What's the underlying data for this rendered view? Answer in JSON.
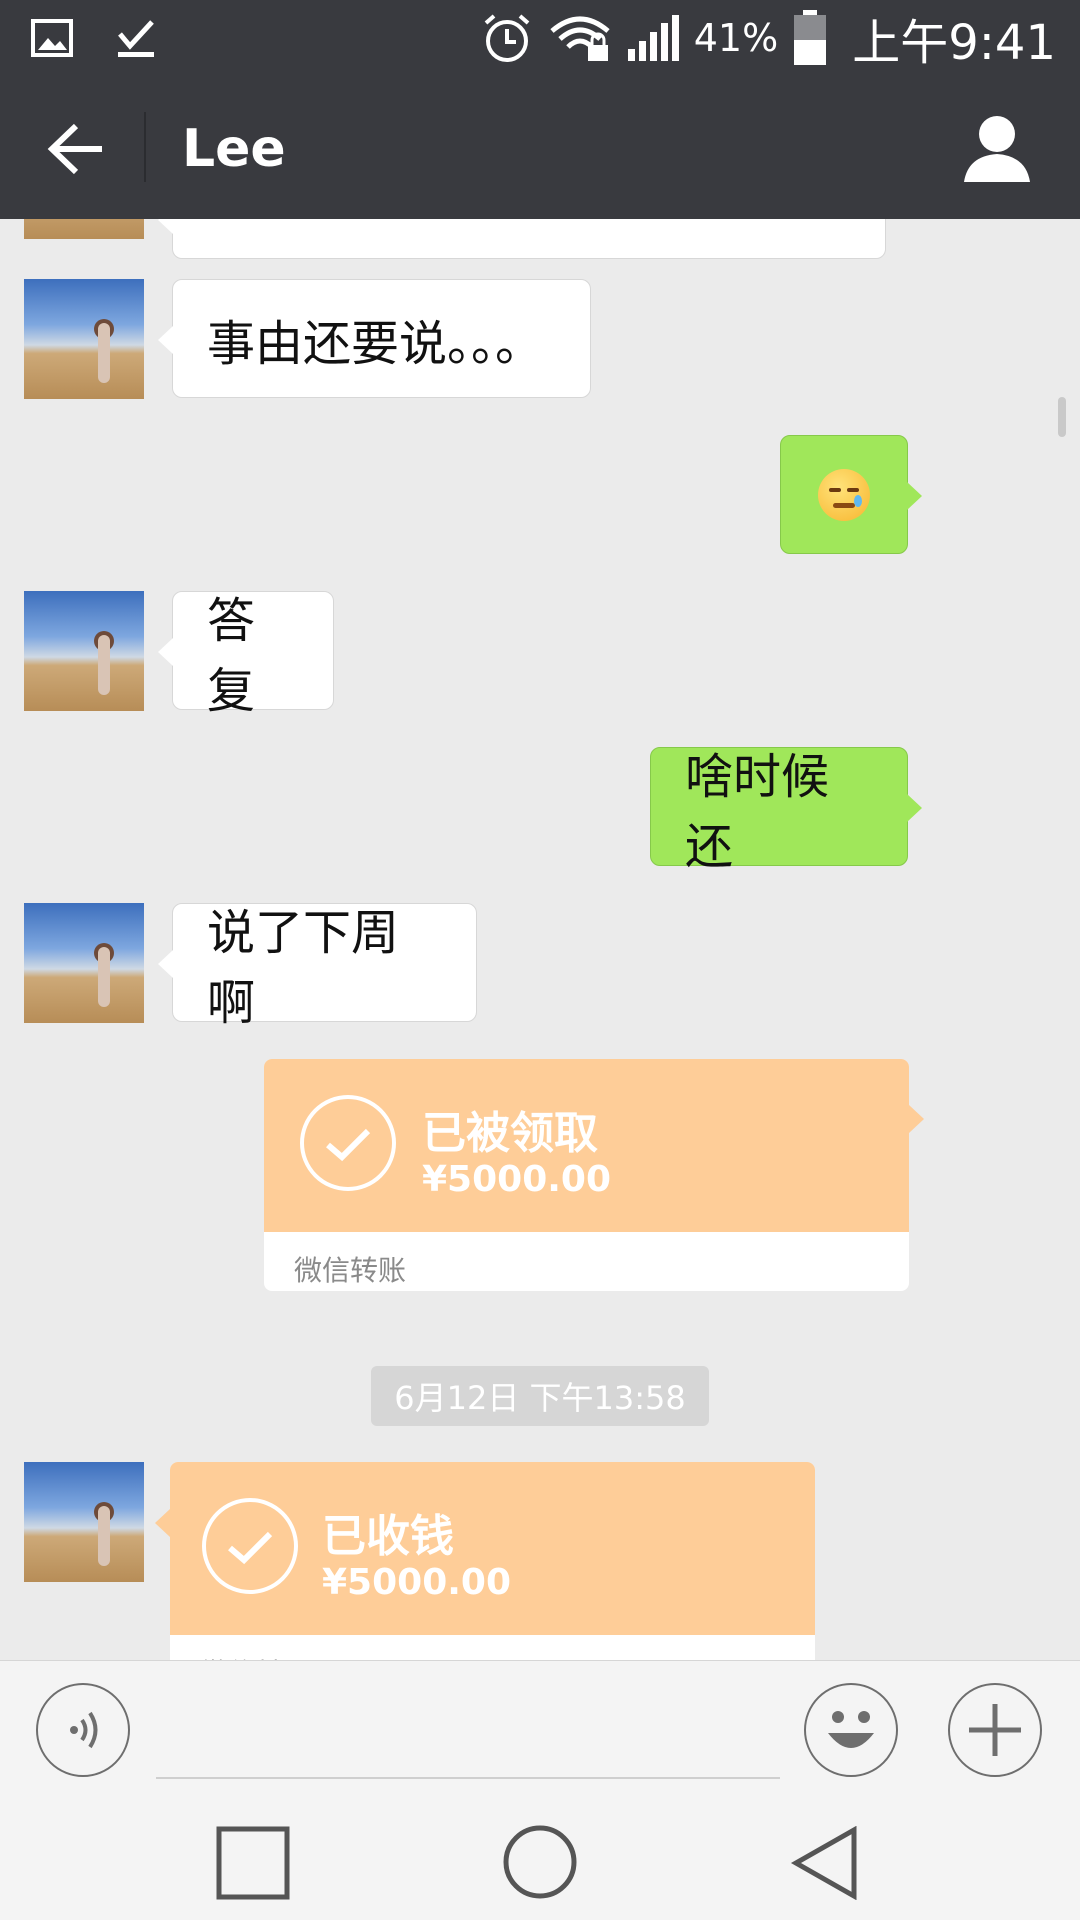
{
  "status_bar": {
    "battery_percent": "41%",
    "time": "上午9:41",
    "icons": [
      "gallery-icon",
      "download-done-icon",
      "alarm-icon",
      "wifi-locked-icon",
      "signal-icon",
      "battery-icon"
    ]
  },
  "nav": {
    "title": "Lee",
    "back_icon": "back-arrow-icon",
    "profile_icon": "person-icon"
  },
  "messages": [
    {
      "side": "left",
      "text": "事由还要说。。。"
    },
    {
      "side": "right",
      "type": "emoji",
      "emoji": "sweat-smile-emoji"
    },
    {
      "side": "left",
      "text": "答复"
    },
    {
      "side": "right",
      "text": "啥时候还"
    },
    {
      "side": "left",
      "text": "说了下周啊"
    },
    {
      "side": "right",
      "type": "transfer",
      "status": "已被领取",
      "amount": "¥5000.00",
      "footer": "微信转账"
    },
    {
      "side": "left",
      "type": "transfer",
      "status": "已收钱",
      "amount": "¥5000.00",
      "footer": "微信转账"
    }
  ],
  "timestamp": "6月12日 下午13:58",
  "input_bar": {
    "voice_icon": "voice-icon",
    "emoji_icon": "emoji-icon",
    "plus_icon": "plus-icon"
  },
  "system_nav": [
    "recents-square-icon",
    "home-circle-icon",
    "back-triangle-icon"
  ],
  "colors": {
    "header": "#393a3f",
    "chat_bg": "#ebebeb",
    "sent_bubble": "#a0e75a",
    "transfer": "#fecd98"
  }
}
